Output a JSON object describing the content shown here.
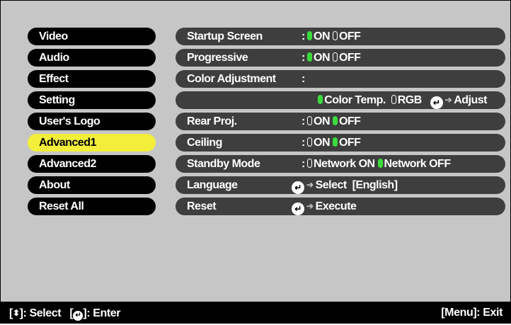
{
  "menu": {
    "items": [
      {
        "label": "Video"
      },
      {
        "label": "Audio"
      },
      {
        "label": "Effect"
      },
      {
        "label": "Setting"
      },
      {
        "label": "User's Logo"
      },
      {
        "label": "Advanced1",
        "active": true
      },
      {
        "label": "Advanced2"
      },
      {
        "label": "About"
      },
      {
        "label": "Reset All"
      }
    ],
    "active_color": "#f2ee3a"
  },
  "settings": {
    "startup_screen": {
      "label": "Startup Screen",
      "colon": ":",
      "on": "ON",
      "off": "OFF",
      "selected": "ON"
    },
    "progressive": {
      "label": "Progressive",
      "colon": ":",
      "on": "ON",
      "off": "OFF",
      "selected": "ON"
    },
    "color_adjustment": {
      "label": "Color Adjustment",
      "colon": ":"
    },
    "color_sub": {
      "color_temp": "Color Temp.",
      "rgb": "RGB",
      "adjust": "Adjust",
      "selected": "Color Temp."
    },
    "rear_proj": {
      "label": "Rear Proj.",
      "colon": ":",
      "on": "ON",
      "off": "OFF",
      "selected": "OFF"
    },
    "ceiling": {
      "label": "Ceiling",
      "colon": ":",
      "on": "ON",
      "off": "OFF",
      "selected": "OFF"
    },
    "standby_mode": {
      "label": "Standby Mode",
      "colon": ":",
      "network_on": "Network ON",
      "network_off": "Network OFF",
      "selected": "Network OFF"
    },
    "language": {
      "label": "Language",
      "action": "Select",
      "value": "[English]"
    },
    "reset": {
      "label": "Reset",
      "action": "Execute"
    }
  },
  "footer": {
    "select_hint": "]: Select",
    "enter_hint": "]: Enter",
    "exit_hint": "[Menu]: Exit"
  },
  "colors": {
    "radio_on": "#3bdc3b",
    "row_bg": "#3e3e3e",
    "panel_bg": "#c6c6c6"
  }
}
